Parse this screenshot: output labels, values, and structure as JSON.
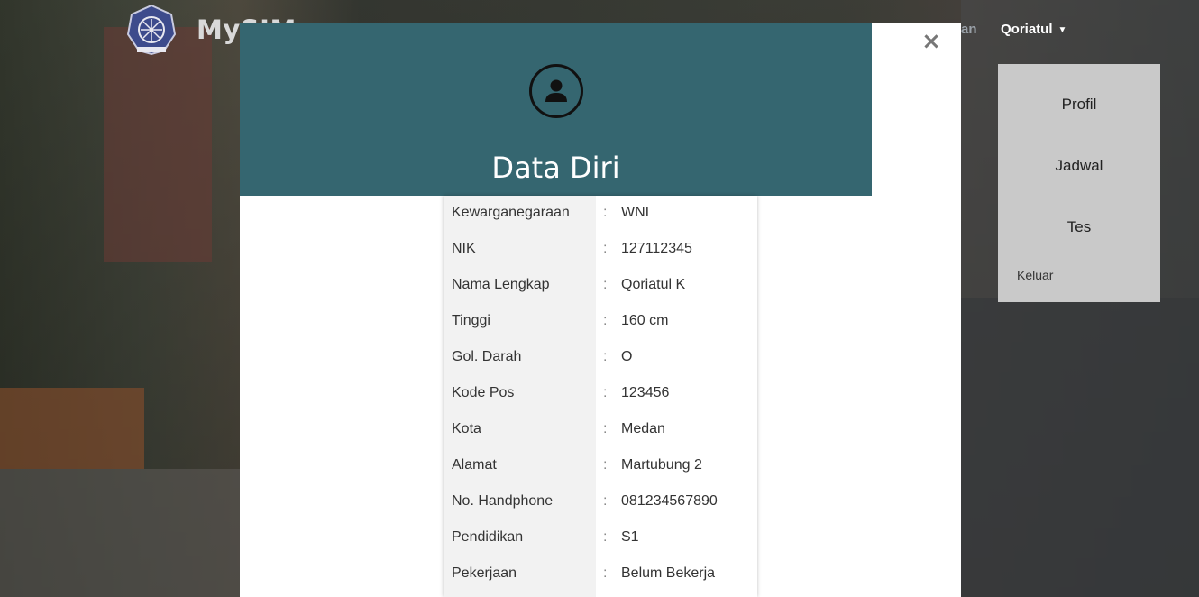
{
  "navbar": {
    "brand": "MySIM",
    "partial_link": "an",
    "user_name": "Qoriatul",
    "user_chevron": "⌄"
  },
  "dropdown": {
    "items": [
      "Profil",
      "Jadwal",
      "Tes"
    ],
    "logout": "Keluar"
  },
  "modal": {
    "close_label": "×",
    "title": "Data Diri",
    "avatar_icon": "user-circle-icon",
    "colors": {
      "header": "#356670"
    },
    "fields": [
      {
        "label": "Kewarganegaraan",
        "sep": ":",
        "value": "WNI"
      },
      {
        "label": "NIK",
        "sep": ":",
        "value": "127112345"
      },
      {
        "label": "Nama Lengkap",
        "sep": ":",
        "value": "Qoriatul K"
      },
      {
        "label": "Tinggi",
        "sep": ":",
        "value": "160 cm"
      },
      {
        "label": "Gol. Darah",
        "sep": ":",
        "value": "O"
      },
      {
        "label": "Kode Pos",
        "sep": ":",
        "value": "123456"
      },
      {
        "label": "Kota",
        "sep": ":",
        "value": "Medan"
      },
      {
        "label": "Alamat",
        "sep": ":",
        "value": "Martubung 2"
      },
      {
        "label": "No. Handphone",
        "sep": ":",
        "value": "081234567890"
      },
      {
        "label": "Pendidikan",
        "sep": ":",
        "value": "S1"
      },
      {
        "label": "Pekerjaan",
        "sep": ":",
        "value": "Belum Bekerja"
      }
    ]
  }
}
